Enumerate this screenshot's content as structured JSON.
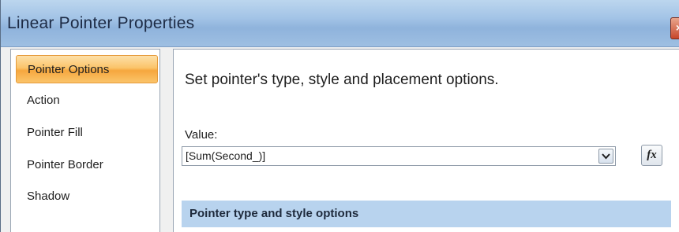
{
  "window": {
    "title": "Linear Pointer Properties",
    "close_glyph": "×"
  },
  "sidebar": {
    "items": [
      {
        "label": "Pointer Options",
        "selected": true
      },
      {
        "label": "Action",
        "selected": false
      },
      {
        "label": "Pointer Fill",
        "selected": false
      },
      {
        "label": "Pointer Border",
        "selected": false
      },
      {
        "label": "Shadow",
        "selected": false
      }
    ]
  },
  "main": {
    "heading": "Set pointer's type, style and placement options.",
    "value_label": "Value:",
    "value_field": "[Sum(Second_)]",
    "fx_label": "fx",
    "section_header": "Pointer type and style options"
  },
  "colors": {
    "selected_item": "#fbc46a",
    "section_header_bg": "#b8d3ee",
    "title_bar": "#a2c3e6"
  }
}
